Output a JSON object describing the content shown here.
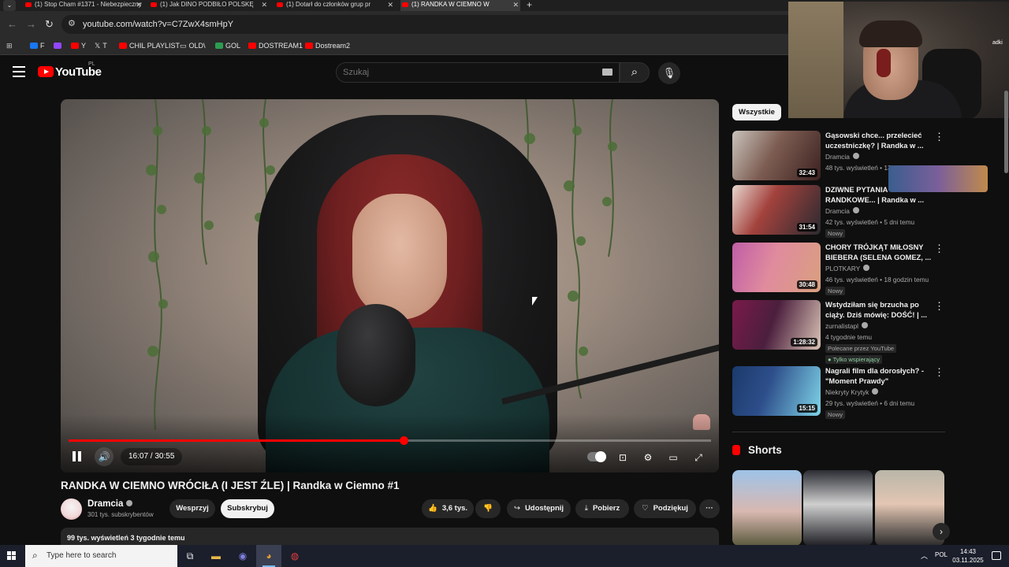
{
  "browser": {
    "tabs": [
      {
        "title": "(1) Stop Cham #1371 - Niebezpieczny"
      },
      {
        "title": "(1) Jak DINO PODBIŁO POLSKĘ"
      },
      {
        "title": "(1) Dotarł do członków grup pr"
      },
      {
        "title": "(1) RANDKA W CIEMNO W"
      }
    ],
    "url": "youtube.com/watch?v=C7ZwX4smHpY",
    "bookmarks": [
      {
        "label": "F",
        "color": "#1877f2"
      },
      {
        "label": "",
        "color": "#9146ff"
      },
      {
        "label": "Y",
        "color": "#ff0000"
      },
      {
        "label": "T",
        "color": "#ffffff"
      },
      {
        "label": "CHIL PLAYLIST",
        "color": "#ff0000"
      },
      {
        "label": "OLD\\",
        "color": "#cccccc"
      },
      {
        "label": "GOL",
        "color": "#2d9c4f"
      },
      {
        "label": "DOSTREAM1",
        "color": "#ff0000"
      },
      {
        "label": "Dostream2",
        "color": "#ff0000"
      }
    ]
  },
  "youtube": {
    "logo_text": "YouTube",
    "country_code": "PL",
    "search_placeholder": "Szukaj"
  },
  "player": {
    "time_display": "16:07 / 30:55",
    "progress_fraction": 0.5213,
    "colors": {
      "progress": "#ff0000"
    }
  },
  "video": {
    "title": "RANDKA W CIEMNO WRÓCIŁA (I JEST ŹLE) | Randka w Ciemno #1",
    "channel": "Dramcia",
    "subscribers": "301 tys. subskrybentów",
    "support_label": "Wesprzyj",
    "subscribe_label": "Subskrybuj",
    "likes": "3,6 tys.",
    "share_label": "Udostępnij",
    "download_label": "Pobierz",
    "thanks_label": "Podziękuj",
    "views_date": "99 tys. wyświetleń  3 tygodnie temu"
  },
  "sidebar": {
    "filter_chip": "Wszystkie",
    "recommendations": [
      {
        "title": "Gąsowski chce... przelecieć uczestniczkę? | Randka w ...",
        "channel": "Dramcia",
        "meta": "48 tys. wyświetleń • 13",
        "duration": "32:43",
        "badge": ""
      },
      {
        "title": "DZIWNE PYTANIA RANDKOWE... | Randka w ...",
        "channel": "Dramcia",
        "meta": "42 tys. wyświetleń • 5 dni temu",
        "duration": "31:54",
        "badge": "Nowy"
      },
      {
        "title": "CHORY TRÓJKĄT MIŁOSNY BIEBERA (SELENA GOMEZ, ...",
        "channel": "PLOTKARY",
        "meta": "46 tys. wyświetleń • 18 godzin temu",
        "duration": "30:48",
        "badge": "Nowy"
      },
      {
        "title": "Wstydziłam się brzucha po ciąży. Dziś mówię: DOŚĆ! | ...",
        "channel": "zurnalistapl",
        "meta": "4 tygodnie temu",
        "duration": "1:28:32",
        "badge": "Polecane przez YouTube",
        "badge2": "Tylko wspierający"
      },
      {
        "title": "Nagrali film dla dorosłych? - \"Moment Prawdy\"",
        "channel": "Niekryty Krytyk",
        "meta": "29 tys. wyświetleń • 6 dni temu",
        "duration": "15:15",
        "badge": "Nowy"
      }
    ],
    "shorts_heading": "Shorts"
  },
  "overlay": {
    "right_edge_text": "adki"
  },
  "taskbar": {
    "search_placeholder": "Type here to search",
    "language": "POL",
    "time": "14:43",
    "date": "03.11.2025"
  }
}
